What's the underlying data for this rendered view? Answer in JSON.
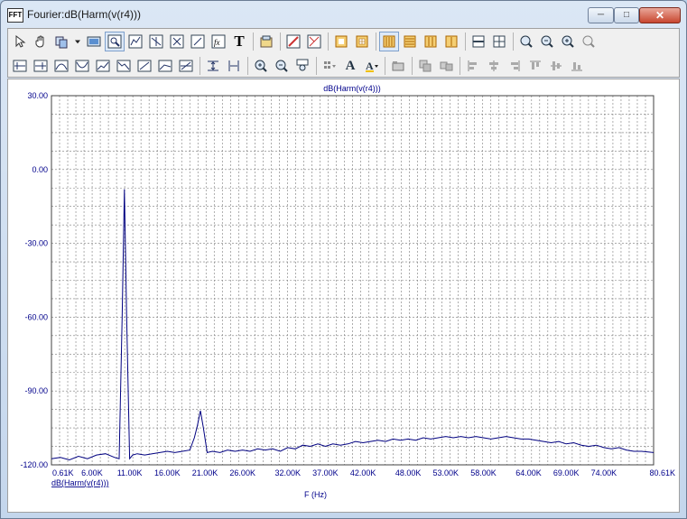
{
  "window": {
    "title": "Fourier:dB(Harm(v(r4)))",
    "icon_text": "FFT"
  },
  "toolbar": {
    "row1": [
      "pointer-icon",
      "pan-hand-icon",
      "copy-icon",
      "dropdown-arrow-icon",
      "image-icon",
      "zoom-window-icon",
      "curve-icon",
      "marker-icon",
      "cursor-icon",
      "function-icon",
      "text-icon",
      "properties-icon",
      "scale-icon",
      "unscale-icon",
      "border-icon",
      "grid-icon",
      "layout-1-icon",
      "layout-2-icon",
      "layout-3-icon",
      "layout-4-icon",
      "single-pane-icon",
      "multi-pane-icon",
      "magnify-1-icon",
      "magnify-2-icon",
      "magnify-3-icon",
      "magnify-4-icon"
    ],
    "row2": [
      "find-peak-icon",
      "find-valley-icon",
      "next-max-icon",
      "next-min-icon",
      "rise-icon",
      "fall-icon",
      "slope-icon",
      "inflection-icon",
      "zero-cross-icon",
      "distance-icon",
      "delta-icon",
      "zoom-in-icon",
      "zoom-out-icon",
      "zoom-fit-icon",
      "tile-icon",
      "font-icon",
      "color-icon",
      "bring-front-icon",
      "align-1-icon",
      "align-2-icon",
      "align-left-icon",
      "align-center-icon",
      "align-right-icon",
      "align-top-icon",
      "align-middle-icon",
      "align-bottom-icon"
    ],
    "text_button_label": "T",
    "font_button_label": "A"
  },
  "chart_data": {
    "type": "line",
    "title": "dB(Harm(v(r4)))",
    "legend": [
      "dB(Harm(v(r4)))"
    ],
    "xlabel": "F (Hz)",
    "ylabel": "",
    "xlim": [
      610,
      80610
    ],
    "ylim": [
      -120,
      30
    ],
    "grid": true,
    "y_ticks": [
      30,
      0,
      -30,
      -60,
      -90,
      -120
    ],
    "y_tick_labels": [
      "30.00",
      "0.00",
      "-30.00",
      "-60.00",
      "-90.00",
      "-120.00"
    ],
    "x_ticks": [
      610,
      6000,
      11000,
      16000,
      21000,
      26000,
      32000,
      37000,
      42000,
      48000,
      53000,
      58000,
      64000,
      69000,
      74000,
      80610
    ],
    "x_tick_labels": [
      "0.61K",
      "6.00K",
      "11.00K",
      "16.00K",
      "21.00K",
      "26.00K",
      "32.00K",
      "37.00K",
      "42.00K",
      "48.00K",
      "53.00K",
      "58.00K",
      "64.00K",
      "69.00K",
      "74.00K",
      "80.61K"
    ],
    "series": [
      {
        "name": "dB(Harm(v(r4)))",
        "color": "#000080",
        "x": [
          610,
          1800,
          3000,
          4200,
          5400,
          6600,
          7800,
          9000,
          9600,
          10000,
          10300,
          10600,
          11000,
          11400,
          12000,
          13000,
          14000,
          15000,
          16000,
          17000,
          18000,
          19000,
          19600,
          20000,
          20400,
          20800,
          21300,
          22000,
          23000,
          24000,
          25000,
          26000,
          27000,
          28000,
          29000,
          30000,
          31000,
          32000,
          33000,
          34000,
          35000,
          36000,
          37000,
          38000,
          39000,
          40000,
          41000,
          42000,
          43000,
          44000,
          45000,
          46000,
          47000,
          48000,
          49000,
          50000,
          51000,
          52000,
          53000,
          54000,
          55000,
          56000,
          57000,
          58000,
          59000,
          60000,
          61000,
          62000,
          63000,
          64000,
          65000,
          66000,
          67000,
          68000,
          69000,
          70000,
          71000,
          72000,
          73000,
          74000,
          75000,
          76000,
          77000,
          78000,
          79000,
          80610
        ],
        "y": [
          -117.5,
          -117,
          -118,
          -116.5,
          -117.5,
          -116,
          -115.5,
          -117,
          -117.5,
          -60,
          -8,
          -60,
          -117.5,
          -116,
          -115.5,
          -116,
          -115.5,
          -115,
          -114.5,
          -115,
          -114.5,
          -114,
          -109,
          -104,
          -98,
          -105,
          -115,
          -114.5,
          -115,
          -114,
          -114.5,
          -114,
          -114.5,
          -113.5,
          -114,
          -113.5,
          -114.5,
          -113,
          -113.5,
          -112,
          -112.5,
          -111.5,
          -112.5,
          -111.5,
          -112,
          -111.5,
          -110.5,
          -111,
          -110.5,
          -110,
          -110.5,
          -109.5,
          -110,
          -109.5,
          -110,
          -109,
          -109.5,
          -109,
          -108.5,
          -109,
          -108.5,
          -109,
          -108.5,
          -109,
          -109.5,
          -109,
          -108.5,
          -109,
          -109.5,
          -109.5,
          -110,
          -110.5,
          -111,
          -110.5,
          -111.5,
          -111,
          -112,
          -112.5,
          -112,
          -113,
          -113.5,
          -113,
          -114,
          -114.5,
          -114.5,
          -115
        ]
      }
    ]
  }
}
